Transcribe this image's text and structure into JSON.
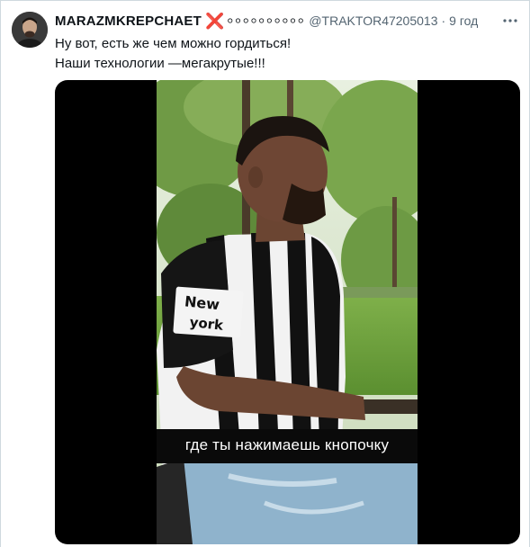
{
  "tweet": {
    "display_name": "MARAZMKREPCHAET",
    "name_emoji_x": "❌",
    "name_emoji_circles": "⚪⚪⚪⚪⚪⚪⚪⚪⚪⚪",
    "handle": "@TRAKTOR47205013",
    "separator": "·",
    "timestamp": "9 год",
    "text_line_1": "Ну вот, есть же чем можно гордиться!",
    "text_line_2": "Наши технологии —мегакрутые!!!",
    "more_icon": "more-horizontal-icon"
  },
  "media": {
    "type": "video",
    "caption": "где ты нажимаешь кнопочку",
    "shirt_text": "New york"
  },
  "colors": {
    "text_primary": "#0f1419",
    "text_secondary": "#536471",
    "border": "#cfd9de",
    "x_red": "#e0245e",
    "media_background": "#000000"
  }
}
